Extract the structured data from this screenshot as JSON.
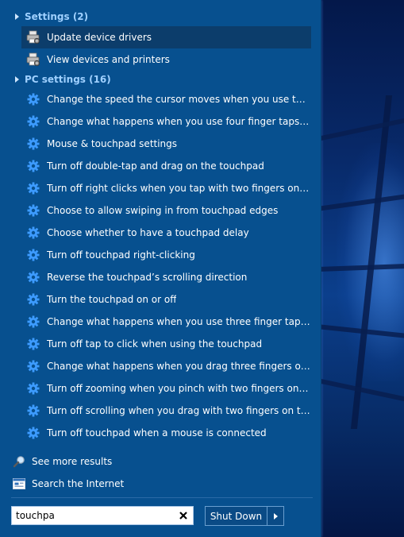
{
  "colors": {
    "panel_bg": "#07508f",
    "group_header_text": "#9fd0ff",
    "selected_row_bg": "#0c3d6b",
    "gear_icon": "#3d9bff"
  },
  "settings_group": {
    "label": "Settings (2)",
    "items": [
      {
        "label": "Update device drivers",
        "icon": "printer-device-icon",
        "selected": true
      },
      {
        "label": "View devices and printers",
        "icon": "printer-device-icon",
        "selected": false
      }
    ]
  },
  "pc_settings_group": {
    "label": "PC settings (16)",
    "items": [
      {
        "label": "Change the speed the cursor moves when you use the touchpad",
        "icon": "gear-icon"
      },
      {
        "label": "Change what happens when you use four finger taps on the touchpad",
        "icon": "gear-icon"
      },
      {
        "label": "Mouse & touchpad settings",
        "icon": "gear-icon"
      },
      {
        "label": "Turn off double-tap and drag on the touchpad",
        "icon": "gear-icon"
      },
      {
        "label": "Turn off right clicks when you tap with two fingers on the touchpad",
        "icon": "gear-icon"
      },
      {
        "label": "Choose to allow swiping in from touchpad edges",
        "icon": "gear-icon"
      },
      {
        "label": "Choose whether to have a touchpad delay",
        "icon": "gear-icon"
      },
      {
        "label": "Turn off touchpad right-clicking",
        "icon": "gear-icon"
      },
      {
        "label": "Reverse the touchpad’s scrolling direction",
        "icon": "gear-icon"
      },
      {
        "label": "Turn the touchpad on or off",
        "icon": "gear-icon"
      },
      {
        "label": "Change what happens when you use three finger taps on the touchpad",
        "icon": "gear-icon"
      },
      {
        "label": "Turn off tap to click when using the touchpad",
        "icon": "gear-icon"
      },
      {
        "label": "Change what happens when you drag three fingers on the touchpad",
        "icon": "gear-icon"
      },
      {
        "label": "Turn off zooming when you pinch with two fingers on the touchpad",
        "icon": "gear-icon"
      },
      {
        "label": "Turn off scrolling when you drag with two fingers on the touchpad",
        "icon": "gear-icon"
      },
      {
        "label": "Turn off touchpad when a mouse is connected",
        "icon": "gear-icon"
      }
    ]
  },
  "footer": {
    "see_more": {
      "label": "See more results",
      "icon": "magnifier-icon"
    },
    "search_internet": {
      "label": "Search the Internet",
      "icon": "browser-window-icon"
    }
  },
  "search": {
    "value": "touchpa",
    "clear_icon": "close-icon"
  },
  "shutdown": {
    "label": "Shut Down",
    "arrow_icon": "chevron-right-icon"
  }
}
